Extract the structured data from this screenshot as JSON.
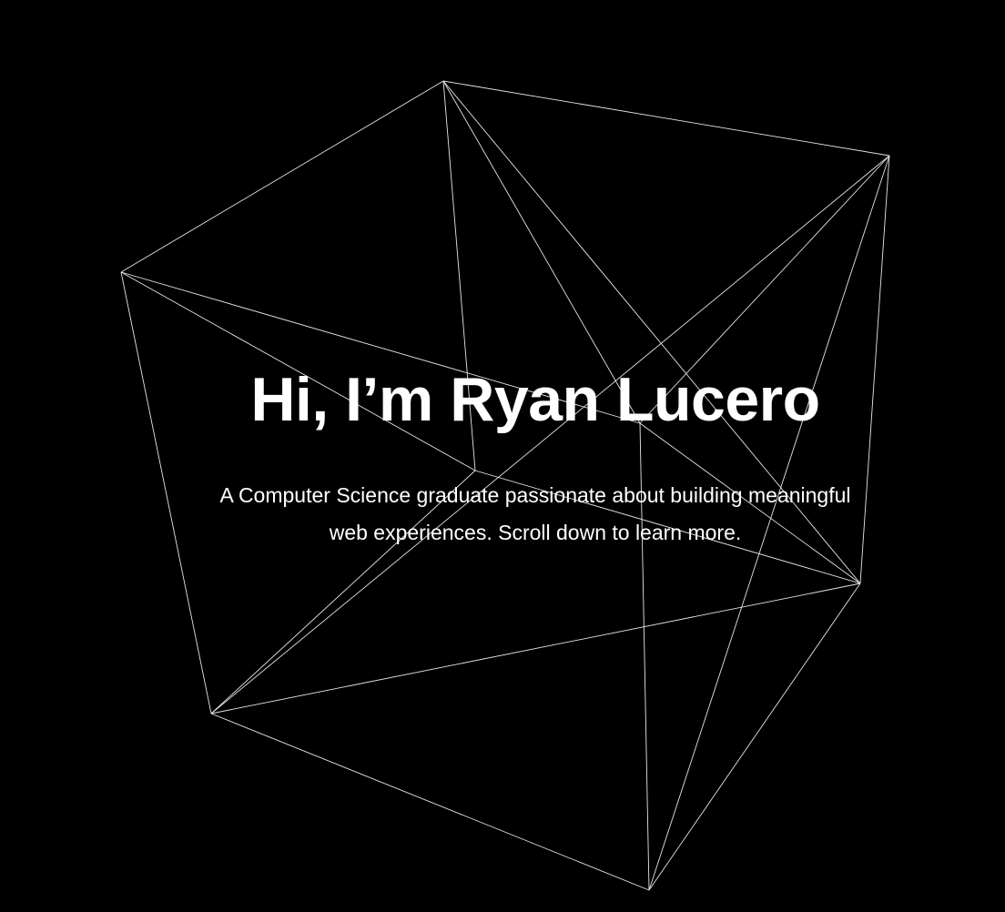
{
  "hero": {
    "title": "Hi, I’m Ryan Lucero",
    "subtitle": "A Computer Science graduate passionate about building meaningful web experiences. Scroll down to learn more."
  },
  "colors": {
    "background": "#000000",
    "text": "#ffffff",
    "wireframe_stroke": "#e6e6e6"
  },
  "decoration": {
    "shape": "wireframe-cube"
  }
}
